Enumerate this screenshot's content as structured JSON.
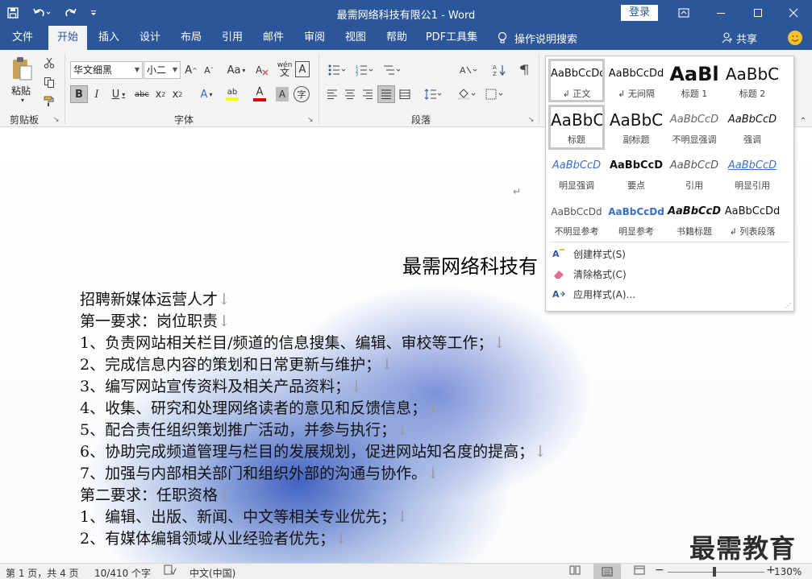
{
  "titlebar": {
    "title": "最需网络科技有限公1  -  Word",
    "login_label": "登录",
    "save_icon": "save-icon",
    "undo_icon": "undo-icon",
    "redo_icon": "redo-icon"
  },
  "tabs": {
    "items": [
      "文件",
      "开始",
      "插入",
      "设计",
      "布局",
      "引用",
      "邮件",
      "审阅",
      "视图",
      "帮助",
      "PDF工具集"
    ],
    "active": "开始",
    "tell_me": "操作说明搜索",
    "share": "共享"
  },
  "ribbon": {
    "clipboard": {
      "paste_label": "粘贴",
      "group_label": "剪贴板"
    },
    "font": {
      "font_name": "华文细黑",
      "font_size": "小二",
      "wen_label": "wén",
      "aa_label": "Aa",
      "group_label": "字体"
    },
    "paragraph": {
      "group_label": "段落"
    }
  },
  "styles_gallery": {
    "items": [
      {
        "preview": "AaBbCcDd",
        "name": "正文",
        "prefix": "↲ "
      },
      {
        "preview": "AaBbCcDd",
        "name": "无间隔",
        "prefix": "↲ "
      },
      {
        "preview": "AaBl",
        "name": "标题 1",
        "prefix": ""
      },
      {
        "preview": "AaBbC",
        "name": "标题 2",
        "prefix": ""
      },
      {
        "preview": "AaBbC",
        "name": "标题",
        "prefix": ""
      },
      {
        "preview": "AaBbC",
        "name": "副标题",
        "prefix": ""
      },
      {
        "preview": "AaBbCcD",
        "name": "不明显强调",
        "prefix": ""
      },
      {
        "preview": "AaBbCcD",
        "name": "强调",
        "prefix": ""
      },
      {
        "preview": "AaBbCcD",
        "name": "明显强调",
        "prefix": ""
      },
      {
        "preview": "AaBbCcD",
        "name": "要点",
        "prefix": ""
      },
      {
        "preview": "AaBbCcD",
        "name": "引用",
        "prefix": ""
      },
      {
        "preview": "AaBbCcD",
        "name": "明显引用",
        "prefix": ""
      },
      {
        "preview": "AaBbCcDd",
        "name": "不明显参考",
        "prefix": ""
      },
      {
        "preview": "AaBbCcDd",
        "name": "明显参考",
        "prefix": ""
      },
      {
        "preview": "AaBbCcD",
        "name": "书籍标题",
        "prefix": ""
      },
      {
        "preview": "AaBbCcDd",
        "name": "列表段落",
        "prefix": "↲ "
      }
    ],
    "commands": [
      "创建样式(S)",
      "清除格式(C)",
      "应用样式(A)..."
    ]
  },
  "document": {
    "paragraph_mark": "↵",
    "title": "最需网络科技有",
    "lines": [
      "招聘新媒体运营人才",
      "第一要求：岗位职责",
      "1、负责网站相关栏目/频道的信息搜集、编辑、审校等工作；",
      "2、完成信息内容的策划和日常更新与维护；",
      "3、编写网站宣传资料及相关产品资料；",
      "4、收集、研究和处理网络读者的意见和反馈信息；",
      "5、配合责任组织策划推广活动，并参与执行；",
      "6、协助完成频道管理与栏目的发展规划，促进网站知名度的提高；",
      "7、加强与内部相关部门和组织外部的沟通与协作。",
      "第二要求：任职资格",
      "1、编辑、出版、新闻、中文等相关专业优先；",
      "2、有媒体编辑领域从业经验者优先；"
    ],
    "line_end_mark": "↓",
    "watermark": "最需教育"
  },
  "statusbar": {
    "page": "第 1 页，共 4 页",
    "words": "10/410 个字",
    "language": "中文(中国)",
    "zoom_minus": "−",
    "zoom_plus": "+",
    "zoom": "130%"
  }
}
